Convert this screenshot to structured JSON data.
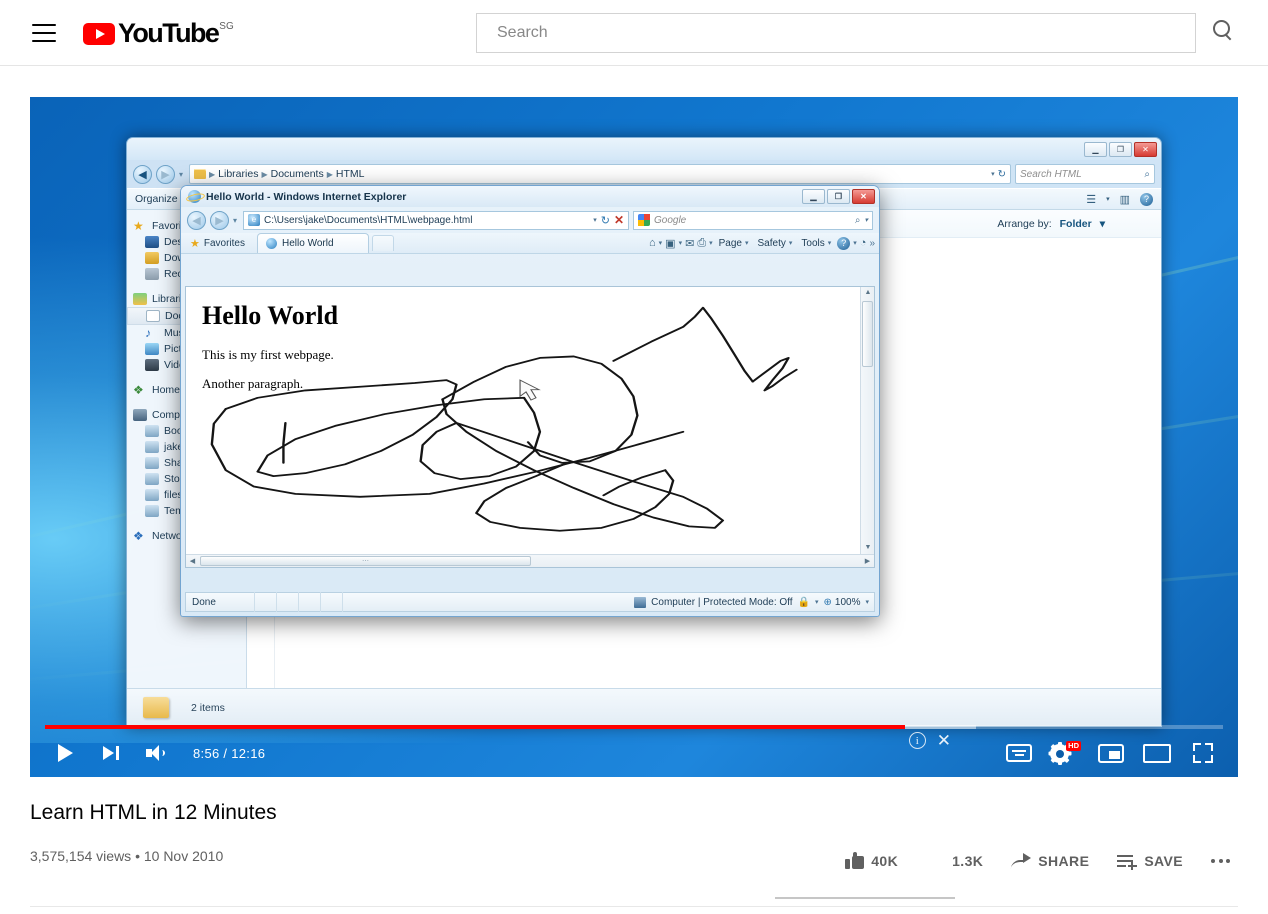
{
  "header": {
    "menu_icon": "hamburger-menu-icon",
    "logo_text": "YouTube",
    "country_code": "SG",
    "search": {
      "value": "",
      "placeholder": "Search"
    },
    "search_icon": "search-icon"
  },
  "player": {
    "current_time": "8:56",
    "duration": "12:16",
    "time_display": "8:56 / 12:16",
    "progress_percent": 73,
    "buffered_percent": 79,
    "quality_badge": "HD",
    "controls": {
      "play": "play-icon",
      "next": "next-video-icon",
      "volume": "volume-icon",
      "subtitles": "subtitles-cc-icon",
      "settings": "settings-gear-icon",
      "miniplayer": "miniplayer-icon",
      "theater": "theater-mode-icon",
      "fullscreen": "fullscreen-icon"
    },
    "card_teaser": {
      "info": "info-icon",
      "close": "close-icon"
    }
  },
  "video": {
    "title": "Learn HTML in 12 Minutes",
    "views": "3,575,154 views",
    "separator": "•",
    "date": "10 Nov 2010",
    "meta": "3,575,154 views • 10 Nov 2010"
  },
  "actions": {
    "like_count": "40K",
    "dislike_count": "1.3K",
    "share_label": "SHARE",
    "save_label": "SAVE",
    "more_label": "more-options"
  },
  "screencast": {
    "explorer": {
      "title_buttons": {
        "minimize": "–",
        "restore": "❐",
        "close": "✕"
      },
      "breadcrumbs": [
        "Libraries",
        "Documents",
        "HTML"
      ],
      "breadcrumb_sep": "▶",
      "search": {
        "placeholder": "Search HTML",
        "value": ""
      },
      "toolbar": {
        "organize": "Organize"
      },
      "arrange_label": "Arrange by:",
      "arrange_value": "Folder",
      "status_items": "2 items",
      "sidebar": [
        {
          "label": "Favorites",
          "icon": "star-icon",
          "group": true
        },
        {
          "label": "Desktop",
          "icon": "desktop-icon"
        },
        {
          "label": "Downloads",
          "icon": "downloads-icon"
        },
        {
          "label": "Recent Places",
          "icon": "recent-places-icon"
        },
        {
          "label": "Libraries",
          "icon": "libraries-icon",
          "group": true
        },
        {
          "label": "Documents",
          "icon": "documents-icon",
          "selected": true
        },
        {
          "label": "Music",
          "icon": "music-icon"
        },
        {
          "label": "Pictures",
          "icon": "pictures-icon"
        },
        {
          "label": "Videos",
          "icon": "videos-icon"
        },
        {
          "label": "Homegroup",
          "icon": "homegroup-icon",
          "group": true
        },
        {
          "label": "Computer",
          "icon": "computer-icon",
          "group": true
        },
        {
          "label": "Boot",
          "icon": "drive-icon"
        },
        {
          "label": "jake",
          "icon": "network-drive-icon"
        },
        {
          "label": "Share",
          "icon": "network-drive-icon"
        },
        {
          "label": "Storage",
          "icon": "network-drive-icon"
        },
        {
          "label": "files",
          "icon": "network-drive-icon"
        },
        {
          "label": "Temp",
          "icon": "network-drive-icon"
        },
        {
          "label": "Network",
          "icon": "network-icon",
          "group": true
        }
      ]
    },
    "ie": {
      "window_title": "Hello World - Windows Internet Explorer",
      "address": "C:\\Users\\jake\\Documents\\HTML\\webpage.html",
      "search_provider_placeholder": "Google",
      "favorites_label": "Favorites",
      "tab_label": "Hello World",
      "command_bar": [
        "Page",
        "Safety",
        "Tools"
      ],
      "command_icons": [
        "home-icon",
        "feeds-icon",
        "mail-icon",
        "print-icon",
        "help-icon",
        "chevron-more-icon"
      ],
      "status": {
        "state": "Done",
        "zone": "Computer | Protected Mode: Off",
        "zoom": "100%"
      },
      "page": {
        "heading": "Hello World",
        "paragraph_1": "This is my first webpage.",
        "paragraph_2": "Another paragraph."
      }
    }
  },
  "colors": {
    "youtube_red": "#ff0000",
    "text_primary": "#030303",
    "text_secondary": "#606060",
    "desktop_blue": "#1177cf"
  }
}
